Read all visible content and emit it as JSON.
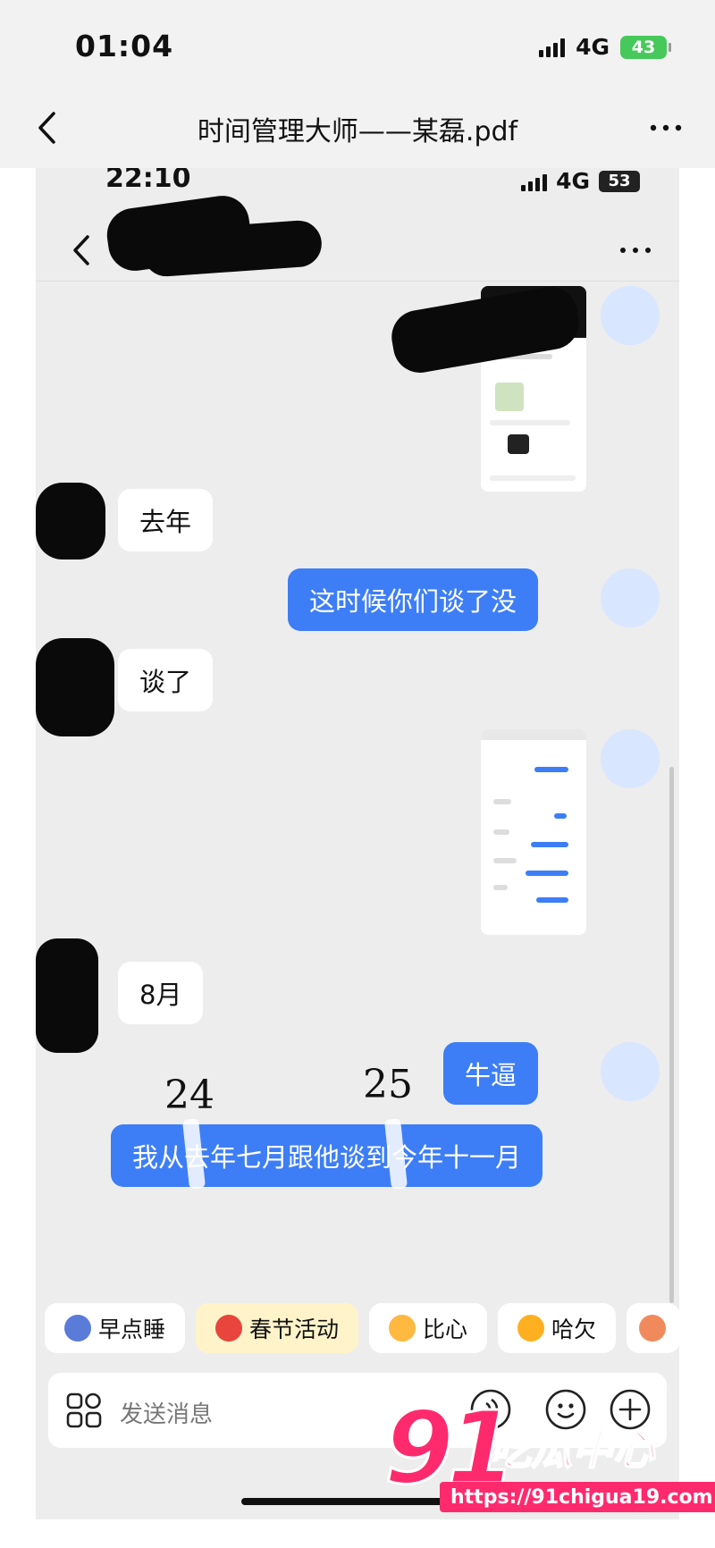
{
  "status_bar": {
    "time": "01:04",
    "network": "4G",
    "battery": "43"
  },
  "viewer": {
    "title": "时间管理大师——某磊.pdf"
  },
  "inner_status_bar": {
    "time": "22:10",
    "network": "4G",
    "battery": "53"
  },
  "messages": [
    {
      "side": "in",
      "text": "去年"
    },
    {
      "side": "out",
      "text": "这时候你们谈了没"
    },
    {
      "side": "in",
      "text": "谈了"
    },
    {
      "side": "in",
      "text": "8月"
    },
    {
      "side": "out",
      "text": "牛逼"
    },
    {
      "side": "out",
      "text": "我从去年七月跟他谈到今年十一月"
    }
  ],
  "annotations": {
    "left": "24",
    "right": "25"
  },
  "quick_chips": [
    {
      "label": "早点睡",
      "icon": "moon-icon",
      "color": "#ffffff"
    },
    {
      "label": "春节活动",
      "icon": "lion-icon",
      "color": "#fff4c9"
    },
    {
      "label": "比心",
      "icon": "heart-hands-icon",
      "color": "#ffffff"
    },
    {
      "label": "哈欠",
      "icon": "yawn-icon",
      "color": "#ffffff"
    }
  ],
  "input": {
    "placeholder": "发送消息"
  },
  "watermark": {
    "number": "91",
    "name": "吃瓜中心",
    "url": "https://91chigua19.com"
  },
  "colors": {
    "accent": "#3d7ef6",
    "avatar": "#d9e6ff",
    "watermark": "#ff2a6d",
    "battery_charging": "#46c95a"
  }
}
